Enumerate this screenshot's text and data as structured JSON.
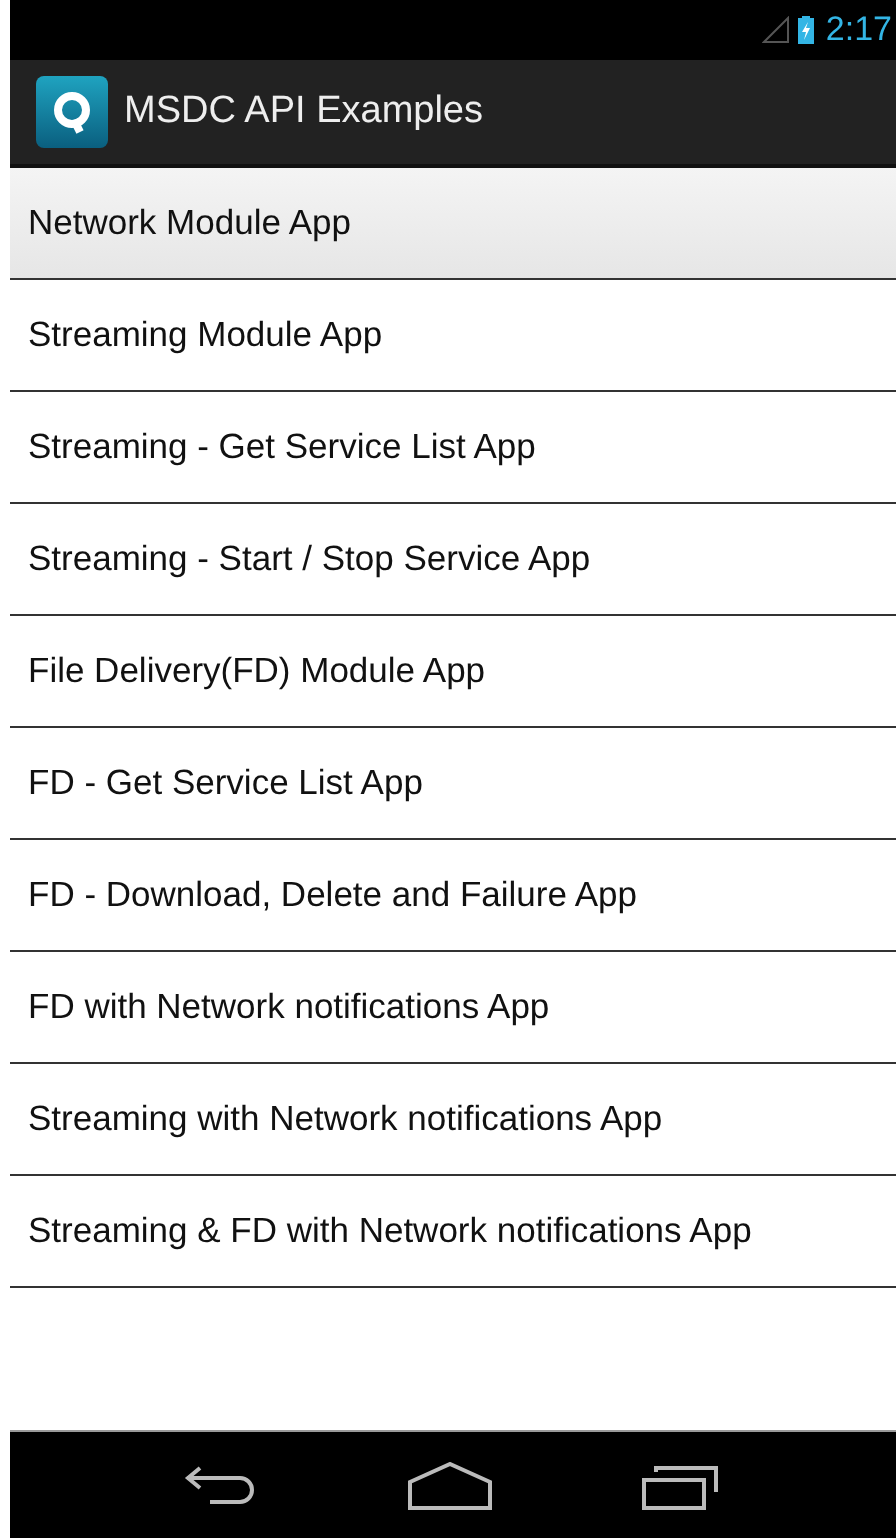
{
  "status_bar": {
    "time": "2:17"
  },
  "action_bar": {
    "title": "MSDC API Examples"
  },
  "items": [
    {
      "label": "Network Module App",
      "selected": true
    },
    {
      "label": "Streaming Module App",
      "selected": false
    },
    {
      "label": "Streaming - Get Service List App",
      "selected": false
    },
    {
      "label": "Streaming - Start / Stop Service App",
      "selected": false
    },
    {
      "label": "File Delivery(FD) Module App",
      "selected": false
    },
    {
      "label": "FD - Get Service List App",
      "selected": false
    },
    {
      "label": "FD - Download, Delete and Failure App",
      "selected": false
    },
    {
      "label": "FD with Network notifications App",
      "selected": false
    },
    {
      "label": "Streaming with Network notifications App",
      "selected": false
    },
    {
      "label": "Streaming & FD with Network notifications App",
      "selected": false
    }
  ]
}
